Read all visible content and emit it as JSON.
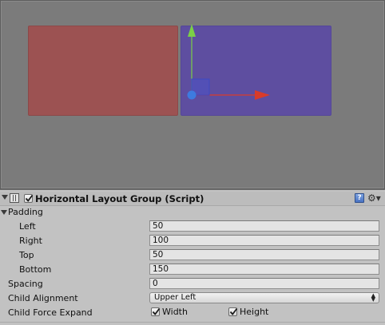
{
  "scene": {
    "panels": [
      {
        "name": "red-panel",
        "color": "#9c5252"
      },
      {
        "name": "purple-panel",
        "color": "#5e4ea0"
      }
    ],
    "gizmo": {
      "y_axis_color": "#7bd046",
      "x_axis_color": "#d93b2a",
      "center_color": "#3d7be0"
    }
  },
  "component": {
    "title": "Horizontal Layout Group (Script)",
    "enabled": true,
    "icons": [
      "foldout-arrow-icon",
      "script-icon",
      "help-icon",
      "gear-icon"
    ]
  },
  "properties": {
    "padding": {
      "label": "Padding",
      "left": {
        "label": "Left",
        "value": "50"
      },
      "right": {
        "label": "Right",
        "value": "100"
      },
      "top": {
        "label": "Top",
        "value": "50"
      },
      "bottom": {
        "label": "Bottom",
        "value": "150"
      }
    },
    "spacing": {
      "label": "Spacing",
      "value": "0"
    },
    "child_alignment": {
      "label": "Child Alignment",
      "value": "Upper Left"
    },
    "child_force_expand": {
      "label": "Child Force Expand",
      "width": {
        "label": "Width",
        "checked": true
      },
      "height": {
        "label": "Height",
        "checked": true
      }
    }
  }
}
